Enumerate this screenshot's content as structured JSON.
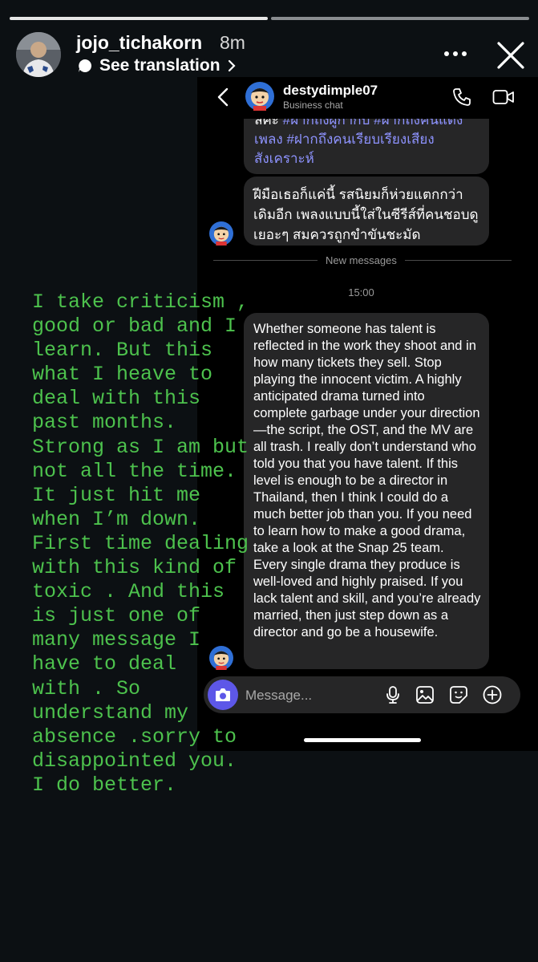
{
  "story": {
    "username": "jojo_tichakorn",
    "time": "8m",
    "see_translation": "See translation",
    "caption_lines": [
      "I take criticism ,",
      "good or bad and I",
      "learn. But this",
      "what I heave to",
      "deal with this",
      "past months.",
      "Strong as I am but",
      "not all the time.",
      "It just hit me",
      "when I’m down.",
      "First time dealing",
      "with this kind of",
      "toxic . And this",
      "is just one of",
      "many message I",
      "have to deal",
      "with . So",
      "understand my",
      "absence .sorry to",
      "disappointed you.",
      "I do better."
    ],
    "caption_color": "#4dc24d"
  },
  "chat": {
    "name": "destydimple07",
    "subtitle": "Business chat",
    "bubble1": {
      "first": "ลค่ะ",
      "hashtags": "#ฝากถึงผู้กำกับ #ฝากถึงคนแต่ง",
      "line2_hashtags": "เพลง #ฝากถึงคนเรียบเรียงเสียง",
      "line3_hashtags": "สังเคราะห์"
    },
    "bubble2": "ฝีมือเธอก็แค่นี้ รสนิยมก็ห่วยแตกกว่าเดิมอีก เพลงแบบนี้ใส่ในซีรีส์ที่คนชอบดูเยอะๆ สมควรถูกขำขันชะมัด",
    "new_messages": "New messages",
    "timestamp": "15:00",
    "bubble3": "Whether someone has talent is reflected in the work they shoot and in how many tickets they sell. Stop playing the innocent victim. A highly anticipated drama turned into complete garbage under your direction—the script, the OST, and the MV are all trash. I really don’t understand who told you that you have talent. If this level is enough to be a director in Thailand, then I think I could do a much better job than you. If you need to learn how to make a good drama, take a look at the Snap 25 team. Every single drama they produce is well-loved and highly praised. If you lack talent and skill, and you’re already married, then just step down as a director and go be a housewife.",
    "composer_placeholder": "Message...",
    "accent": "#5d57e8",
    "hashtag_color": "#8e93ff"
  },
  "icons": {
    "more": "more-horizontal-icon",
    "close": "close-icon",
    "back": "chevron-left-icon",
    "phone": "phone-icon",
    "video": "video-camera-icon",
    "camera": "camera-icon",
    "mic": "microphone-icon",
    "gallery": "image-icon",
    "sticker": "sticker-icon",
    "add": "plus-circle-icon"
  }
}
